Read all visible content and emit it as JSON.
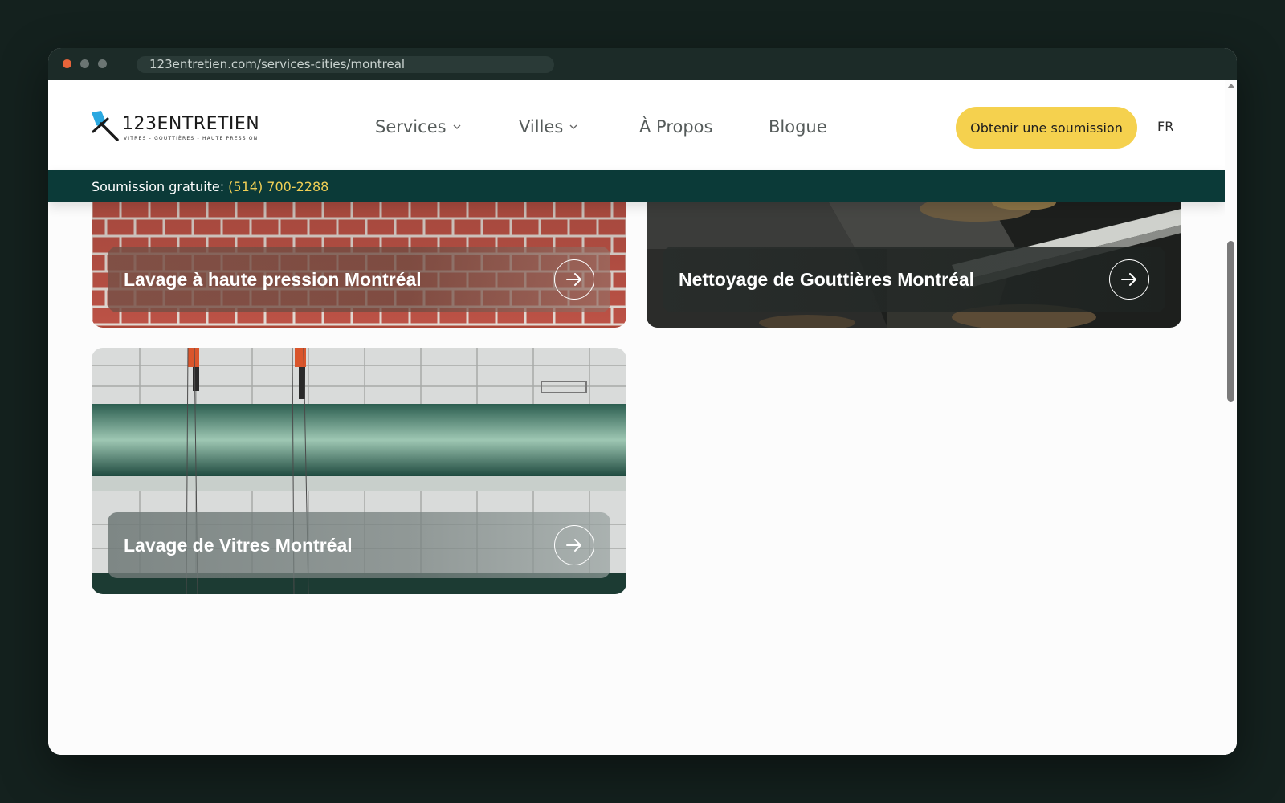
{
  "browser": {
    "url": "123entretien.com/services-cities/montreal"
  },
  "header": {
    "logo_name": "123ENTRETIEN",
    "logo_tagline": "VITRES - GOUTTIÈRES - HAUTE PRESSION",
    "nav": [
      {
        "label": "Services",
        "has_dropdown": true
      },
      {
        "label": "Villes",
        "has_dropdown": true
      },
      {
        "label": "À Propos",
        "has_dropdown": false
      },
      {
        "label": "Blogue",
        "has_dropdown": false
      }
    ],
    "cta_label": "Obtenir une soumission",
    "lang": "FR"
  },
  "promo": {
    "label": "Soumission gratuite:",
    "phone": "(514) 700-2288"
  },
  "cards": [
    {
      "title": "Lavage à haute pression Montréal",
      "image": "brick-wall-photo"
    },
    {
      "title": "Nettoyage de Gouttières Montréal",
      "image": "gutter-leaves-photo"
    },
    {
      "title": "Lavage de Vitres Montréal",
      "image": "window-washers-building-photo"
    }
  ],
  "colors": {
    "accent_yellow": "#f5d14e",
    "promo_bar": "#0b3a38",
    "phone": "#f0cf55"
  }
}
